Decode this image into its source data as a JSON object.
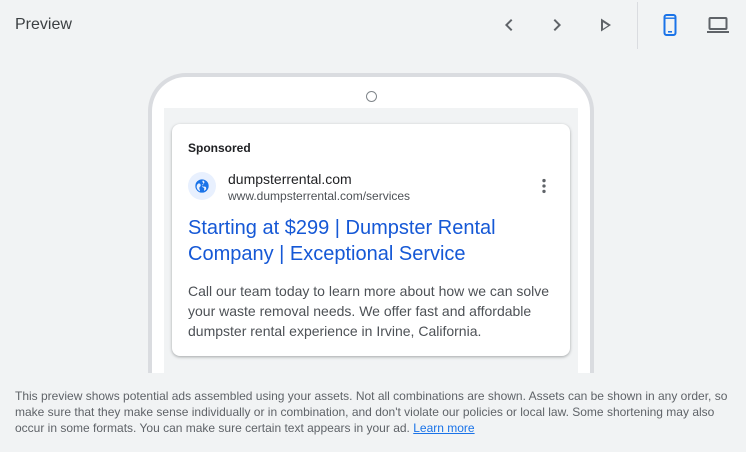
{
  "header": {
    "title": "Preview",
    "icons": [
      "chevron-left-icon",
      "chevron-right-icon",
      "play-icon",
      "mobile-device-icon",
      "laptop-icon"
    ],
    "accent": "#1a73e8"
  },
  "ad": {
    "sponsored_label": "Sponsored",
    "site_name": "dumpsterrental.com",
    "display_url": "www.dumpsterrental.com/services",
    "headline": "Starting at $299 | Dumpster Rental Company | Exceptional Service",
    "description": "Call our team today to learn more about how we can solve your waste removal needs. We offer fast and affordable dumpster rental experience in Irvine, California.",
    "headline_color": "#1558d6"
  },
  "footer": {
    "notice": "This preview shows potential ads assembled using your assets. Not all combinations are shown. Assets can be shown in any order, so make sure that they make sense individually or in combination, and don't violate our policies or local law. Some shortening may also occur in some formats. You can make sure certain text appears in your ad.",
    "learn_more": "Learn more"
  }
}
